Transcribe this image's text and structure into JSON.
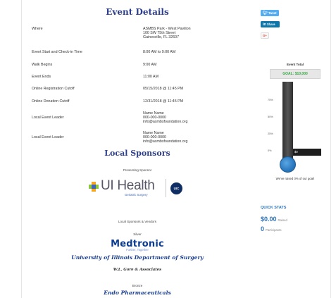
{
  "event_details": {
    "title": "Event Details",
    "rows": [
      {
        "label": "Where",
        "value": "ASMBS Park - West Pavilion\n100 SW 75th Street\nGainesville, FL 32607"
      },
      {
        "label": "Event Start and Check-in Time",
        "value": "8:00 AM to 9:00 AM"
      },
      {
        "label": "Walk Begins",
        "value": "9:00 AM"
      },
      {
        "label": "Event Ends",
        "value": "11:00 AM"
      },
      {
        "label": "Online Registration Cutoff",
        "value": "05/15/2018 @ 11:45 PM"
      },
      {
        "label": "Online Donation Cutoff",
        "value": "12/31/2018 @ 11:45 PM"
      },
      {
        "label": "Local Event Leader",
        "value": "Name Name\n000-000-0000\ninfo@asmbsfoundation.org"
      },
      {
        "label": "Local Event Leader",
        "value": "Name Name\n000-000-0000\ninfo@asmbsfoundation.org"
      }
    ]
  },
  "sponsors": {
    "title": "Local Sponsors",
    "presenting_label": "Presenting Sponsor",
    "presenting_name": "UI Health",
    "presenting_sub": "Geriatric Surgery",
    "presenting_badge": "UIC",
    "section_label": "Local Sponsors & Vendors",
    "silver_label": "Silver",
    "silver_1": "Medtronic",
    "silver_1_tagline": "Further, Together",
    "silver_2": "University of Illinois Department of Surgery",
    "silver_3": "W.L. Gore & Associates",
    "bronze_label": "Bronze",
    "bronze_1": "Endo Pharmaceuticals"
  },
  "share": {
    "tweet": "Tweet",
    "linkedin": "Share",
    "google": "G+"
  },
  "thermometer": {
    "title": "Event Total",
    "goal": "GOAL: $10,000",
    "ticks": [
      "75%",
      "50%",
      "25%",
      "0%"
    ],
    "marker": "$0",
    "raised_text": "We've raised 0% of our goal!",
    "fill_fraction": 0.0
  },
  "quick_stats": {
    "title": "QUICK STATS",
    "raised_value": "$0.00",
    "raised_label": "Raised",
    "participants_value": "0",
    "participants_label": "Participants"
  },
  "colors": {
    "heading": "#2c3e8c",
    "twitter": "#55acee",
    "linkedin": "#0e76a8",
    "goal_green": "#39a845",
    "stats_blue": "#2e73b8"
  }
}
